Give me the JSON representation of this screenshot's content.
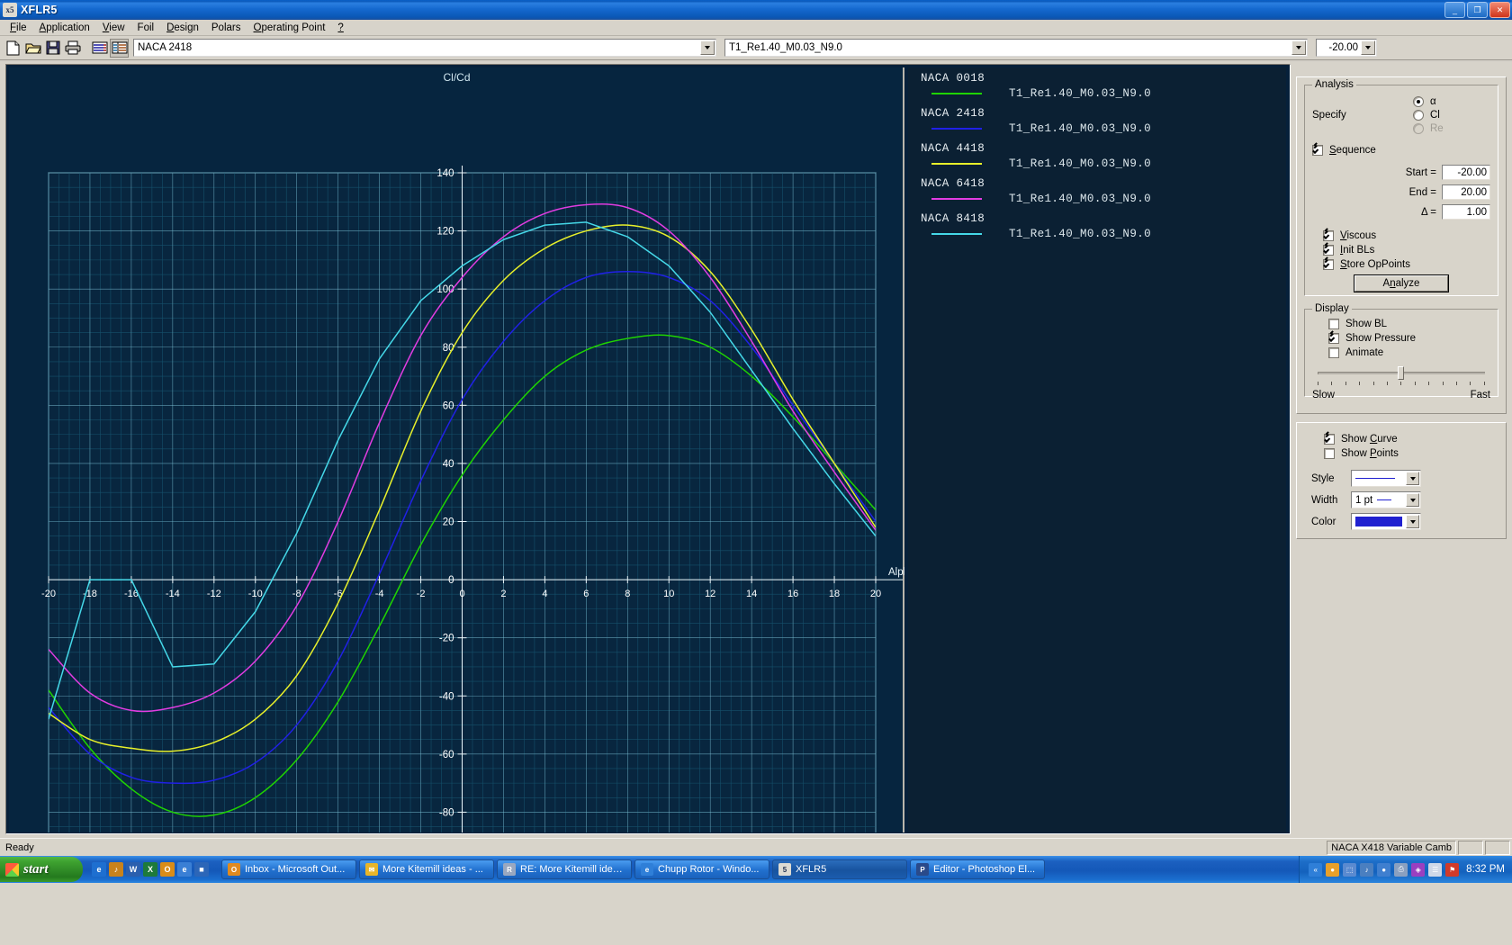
{
  "window": {
    "title": "XFLR5",
    "app_icon": "xflr5-icon",
    "minimize_label": "_",
    "maximize_label": "❐",
    "close_label": "✕"
  },
  "menubar": {
    "items": [
      {
        "label": "File",
        "mnemonic": "F"
      },
      {
        "label": "Application",
        "mnemonic": "A"
      },
      {
        "label": "View",
        "mnemonic": "V"
      },
      {
        "label": "Foil",
        "mnemonic": "F"
      },
      {
        "label": "Design",
        "mnemonic": "D"
      },
      {
        "label": "Polars",
        "mnemonic": "P"
      },
      {
        "label": "Operating Point",
        "mnemonic": "O"
      },
      {
        "label": "?",
        "mnemonic": "?"
      }
    ]
  },
  "toolbar": {
    "buttons": [
      {
        "name": "new-file-icon",
        "tip": "New"
      },
      {
        "name": "open-folder-icon",
        "tip": "Open"
      },
      {
        "name": "save-disk-icon",
        "tip": "Save"
      },
      {
        "name": "print-icon",
        "tip": "Print"
      },
      {
        "name": "polars-view-icon",
        "tip": "Polars"
      },
      {
        "name": "oppoint-view-icon",
        "tip": "Operating point"
      }
    ],
    "foil_combo_value": "NACA 2418",
    "polar_combo_value": "T1_Re1.40_M0.03_N9.0",
    "alpha_combo_value": "-20.00"
  },
  "graph": {
    "title": "Cl/Cd",
    "xlabel": "Alpha"
  },
  "legend": {
    "entries": [
      {
        "foil": "NACA 0018",
        "polar": "T1_Re1.40_M0.03_N9.0",
        "color": "#1fd400"
      },
      {
        "foil": "NACA 2418",
        "polar": "T1_Re1.40_M0.03_N9.0",
        "color": "#2020e6"
      },
      {
        "foil": "NACA 4418",
        "polar": "T1_Re1.40_M0.03_N9.0",
        "color": "#e8f02a"
      },
      {
        "foil": "NACA 6418",
        "polar": "T1_Re1.40_M0.03_N9.0",
        "color": "#e23ce2"
      },
      {
        "foil": "NACA 8418",
        "polar": "T1_Re1.40_M0.03_N9.0",
        "color": "#45d8e8"
      }
    ]
  },
  "analysis_panel": {
    "group_label": "Analysis",
    "specify_label": "Specify",
    "specify_options": [
      {
        "label": "α",
        "selected": true,
        "disabled": false
      },
      {
        "label": "Cl",
        "selected": false,
        "disabled": false
      },
      {
        "label": "Re",
        "selected": false,
        "disabled": true
      }
    ],
    "sequence_label": "Sequence",
    "sequence_checked": true,
    "start_label": "Start =",
    "start_value": "-20.00",
    "end_label": "End =",
    "end_value": "20.00",
    "delta_label": "Δ =",
    "delta_value": "1.00",
    "viscous_label": "Viscous",
    "viscous_checked": true,
    "init_bls_label": "Init BLs",
    "init_bls_checked": true,
    "store_oppoints_label": "Store OpPoints",
    "store_oppoints_checked": true,
    "analyze_label": "Analyze"
  },
  "display_panel": {
    "group_label": "Display",
    "show_bl_label": "Show BL",
    "show_bl_checked": false,
    "show_pressure_label": "Show Pressure",
    "show_pressure_checked": true,
    "animate_label": "Animate",
    "animate_checked": false,
    "slider_min_label": "Slow",
    "slider_max_label": "Fast",
    "slider_position_percent": 48
  },
  "curve_panel": {
    "show_curve_label": "Show Curve",
    "show_curve_checked": true,
    "show_points_label": "Show Points",
    "show_points_checked": false,
    "style_label": "Style",
    "style_value": "",
    "width_label": "Width",
    "width_value": "1 pt",
    "color_label": "Color",
    "color_value": "#2020d0"
  },
  "statusbar": {
    "message": "Ready",
    "panels": [
      "NACA X418 Variable Camb",
      "",
      ""
    ]
  },
  "taskbar": {
    "start_label": "start",
    "quick_launch": [
      {
        "name": "ie-quicklaunch-icon",
        "color": "#1e6fd0",
        "glyph": "e"
      },
      {
        "name": "media-quicklaunch-icon",
        "color": "#c8821c",
        "glyph": "♪"
      },
      {
        "name": "word-quicklaunch-icon",
        "color": "#2b5fae",
        "glyph": "W"
      },
      {
        "name": "excel-quicklaunch-icon",
        "color": "#1d7a3c",
        "glyph": "X"
      },
      {
        "name": "outlook-quicklaunch-icon",
        "color": "#d98c18",
        "glyph": "O"
      },
      {
        "name": "browser-quicklaunch-icon",
        "color": "#3a7fd5",
        "glyph": "e"
      },
      {
        "name": "desktop-quicklaunch-icon",
        "color": "#2c66b8",
        "glyph": "■"
      }
    ],
    "tasks": [
      {
        "label": "Inbox - Microsoft Out...",
        "icon": "outlook-icon",
        "color": "#e08a1e",
        "glyph": "O",
        "active": false
      },
      {
        "label": "More Kitemill ideas - ...",
        "icon": "mail-icon",
        "color": "#e8b52a",
        "glyph": "✉",
        "active": false
      },
      {
        "label": "RE: More Kitemill idea...",
        "icon": "mail-reply-icon",
        "color": "#9aa8c0",
        "glyph": "R",
        "active": false
      },
      {
        "label": "Chupp Rotor - Windo...",
        "icon": "ie-icon",
        "color": "#2f7fd8",
        "glyph": "e",
        "active": false
      },
      {
        "label": "XFLR5",
        "icon": "xflr5-icon",
        "color": "#dedbd2",
        "glyph": "5",
        "active": true
      },
      {
        "label": "Editor - Photoshop El...",
        "icon": "photoshop-icon",
        "color": "#2a4a8a",
        "glyph": "P",
        "active": false
      }
    ],
    "tray_icons": [
      {
        "name": "show-hidden-icons-icon",
        "color": "#2f7fd8",
        "glyph": "«"
      },
      {
        "name": "shield-icon",
        "color": "#e8a02a",
        "glyph": "●"
      },
      {
        "name": "network-icon",
        "color": "#5a8ad0",
        "glyph": "⬚"
      },
      {
        "name": "volume-icon",
        "color": "#4a7fc0",
        "glyph": "♪"
      },
      {
        "name": "search-icon",
        "color": "#3f7fcf",
        "glyph": "●"
      },
      {
        "name": "printer-icon",
        "color": "#8aa0c0",
        "glyph": "⎙"
      },
      {
        "name": "usb-icon",
        "color": "#9a3fc0",
        "glyph": "◈"
      },
      {
        "name": "files-icon",
        "color": "#cfd8e8",
        "glyph": "☰"
      },
      {
        "name": "antivirus-icon",
        "color": "#d03a2a",
        "glyph": "⚑"
      }
    ],
    "clock": "8:32 PM"
  },
  "chart_data": {
    "type": "line",
    "title": "Cl/Cd",
    "xlabel": "Alpha",
    "ylabel": "Cl/Cd",
    "xlim": [
      -20,
      20
    ],
    "ylim": [
      -100,
      140
    ],
    "xticks": [
      -20,
      -18,
      -16,
      -14,
      -12,
      -10,
      -8,
      -6,
      -4,
      -2,
      0,
      2,
      4,
      6,
      8,
      10,
      12,
      14,
      16,
      18,
      20
    ],
    "yticks": [
      -100,
      -80,
      -60,
      -40,
      -20,
      0,
      20,
      40,
      60,
      80,
      100,
      120,
      140
    ],
    "grid": true,
    "legend_position": "right",
    "x": [
      -20,
      -18,
      -16,
      -14,
      -12,
      -10,
      -8,
      -6,
      -4,
      -2,
      0,
      2,
      4,
      6,
      8,
      10,
      12,
      14,
      16,
      18,
      20
    ],
    "series": [
      {
        "name": "NACA 0018 / T1_Re1.40_M0.03_N9.0",
        "color": "#1fd400",
        "values": [
          -38,
          -58,
          -72,
          -80,
          -81,
          -75,
          -62,
          -42,
          -16,
          12,
          36,
          55,
          70,
          79,
          83,
          84,
          80,
          70,
          56,
          40,
          24
        ]
      },
      {
        "name": "NACA 2418 / T1_Re1.40_M0.03_N9.0",
        "color": "#2020e6",
        "values": [
          -44,
          -60,
          -68,
          -70,
          -69,
          -63,
          -50,
          -28,
          2,
          34,
          62,
          82,
          96,
          104,
          106,
          104,
          96,
          80,
          60,
          40,
          20
        ]
      },
      {
        "name": "NACA 4418 / T1_Re1.40_M0.03_N9.0",
        "color": "#e8f02a",
        "values": [
          -46,
          -55,
          -58,
          -59,
          -56,
          -48,
          -33,
          -8,
          24,
          58,
          85,
          103,
          114,
          120,
          122,
          118,
          106,
          86,
          62,
          40,
          18
        ]
      },
      {
        "name": "NACA 6418 / T1_Re1.40_M0.03_N9.0",
        "color": "#e23ce2",
        "values": [
          -24,
          -39,
          -45,
          -44,
          -39,
          -28,
          -9,
          20,
          54,
          84,
          104,
          118,
          126,
          129,
          128,
          120,
          104,
          82,
          58,
          37,
          17
        ]
      },
      {
        "name": "NACA 8418 / T1_Re1.40_M0.03_N9.0",
        "color": "#45d8e8",
        "values": [
          -48,
          0,
          0,
          -30,
          -29,
          -11,
          16,
          48,
          76,
          96,
          108,
          117,
          122,
          123,
          118,
          108,
          92,
          72,
          52,
          33,
          15
        ]
      }
    ]
  }
}
